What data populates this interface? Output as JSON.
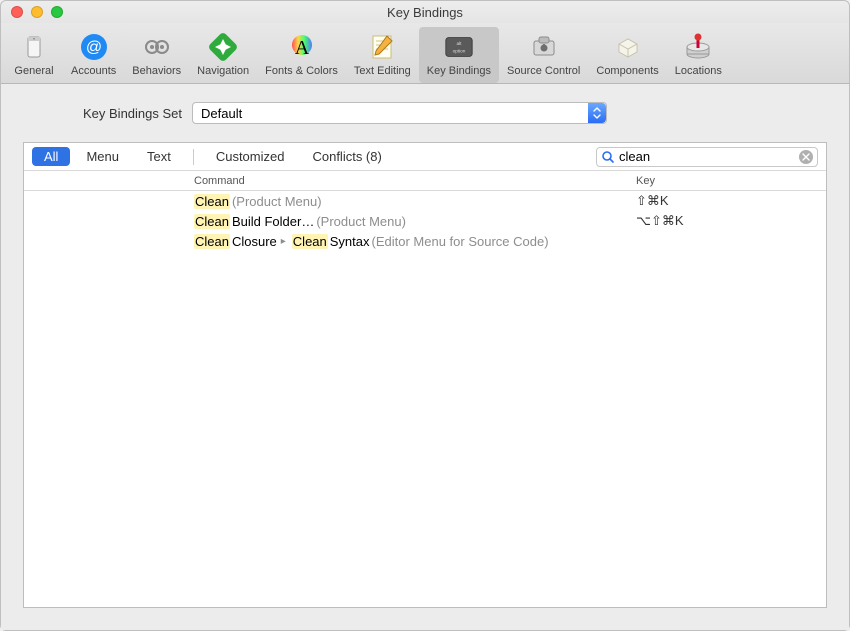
{
  "window": {
    "title": "Key Bindings"
  },
  "toolbar": [
    {
      "id": "general",
      "label": "General"
    },
    {
      "id": "accounts",
      "label": "Accounts"
    },
    {
      "id": "behaviors",
      "label": "Behaviors"
    },
    {
      "id": "navigation",
      "label": "Navigation"
    },
    {
      "id": "fonts-colors",
      "label": "Fonts & Colors"
    },
    {
      "id": "text-editing",
      "label": "Text Editing"
    },
    {
      "id": "key-bindings",
      "label": "Key Bindings",
      "active": true
    },
    {
      "id": "source-control",
      "label": "Source Control"
    },
    {
      "id": "components",
      "label": "Components"
    },
    {
      "id": "locations",
      "label": "Locations"
    }
  ],
  "set": {
    "label": "Key Bindings Set",
    "value": "Default"
  },
  "scope": {
    "tabs": {
      "all": "All",
      "menu": "Menu",
      "text": "Text",
      "customized": "Customized",
      "conflicts": "Conflicts (8)"
    },
    "active": "all"
  },
  "search": {
    "value": "clean",
    "placeholder": ""
  },
  "columns": {
    "command": "Command",
    "key": "Key"
  },
  "rows": [
    {
      "parts": [
        {
          "text": "Clean",
          "hl": true
        },
        {
          "text": " (Product Menu)",
          "ctx": true
        }
      ],
      "key": "⇧⌘K"
    },
    {
      "parts": [
        {
          "text": "Clean",
          "hl": true
        },
        {
          "text": " Build Folder…"
        },
        {
          "text": " (Product Menu)",
          "ctx": true
        }
      ],
      "key": "⌥⇧⌘K"
    },
    {
      "parts": [
        {
          "text": "Clean",
          "hl": true
        },
        {
          "text": " Closure "
        },
        {
          "text": "▸",
          "chevron": true
        },
        {
          "text": " "
        },
        {
          "text": "Clean",
          "hl": true
        },
        {
          "text": " Syntax"
        },
        {
          "text": " (Editor Menu for Source Code)",
          "ctx": true
        }
      ],
      "key": ""
    }
  ]
}
